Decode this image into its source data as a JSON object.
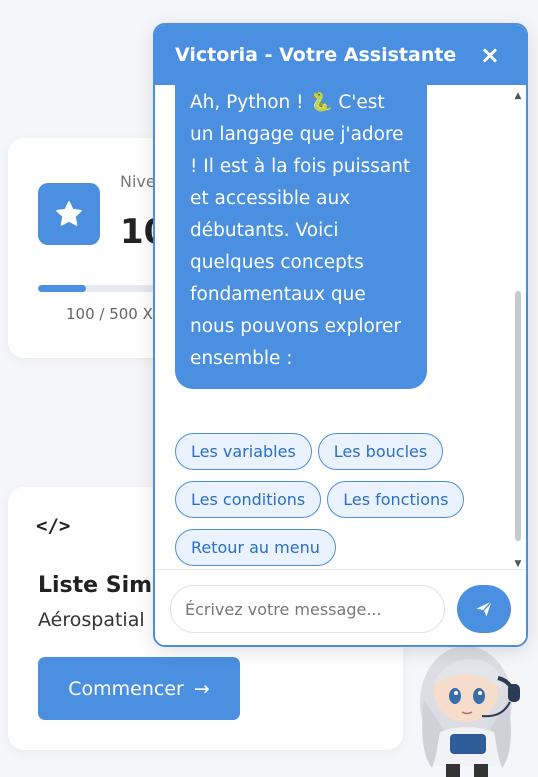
{
  "level_card": {
    "label": "Nive",
    "value": "10",
    "xp_text": "100 / 500 X",
    "progress_fraction": 0.2,
    "icon": "star-icon"
  },
  "course_card": {
    "icon_text": "</>",
    "title": "Liste Simp",
    "subtitle": "Aérospatial",
    "start_label": "Commencer",
    "start_arrow": "→"
  },
  "chat": {
    "title": "Victoria - Votre Assistante",
    "close_label": "×",
    "message_before_emoji": "Ah, Python ! ",
    "message_emoji": "🐍",
    "message_after_emoji": " C'est un langage que j'adore ! Il est à la fois puissant et accessible aux débutants. Voici quelques concepts fondamentaux que nous pouvons explorer ensemble :",
    "options": [
      "Les variables",
      "Les boucles",
      "Les conditions",
      "Les fonctions",
      "Retour au menu"
    ],
    "input_placeholder": "Écrivez votre message...",
    "send_icon": "paper-plane-icon"
  },
  "colors": {
    "accent": "#4a8fe0",
    "chip_bg": "#eaf2fd",
    "page_bg": "#f5f6fa"
  }
}
